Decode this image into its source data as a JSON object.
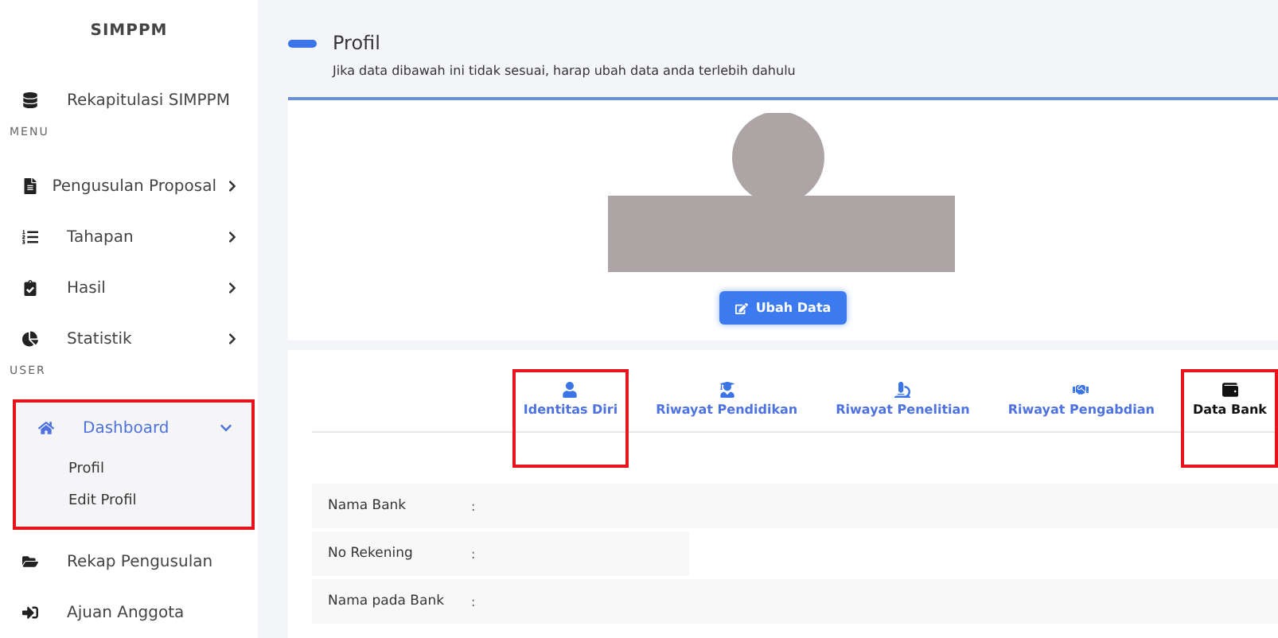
{
  "sidebar": {
    "title": "SIMPPM",
    "items": [
      {
        "kind": "link",
        "label": "Rekapitulasi SIMPPM",
        "expandable": false
      },
      {
        "kind": "heading",
        "label": "MENU"
      },
      {
        "kind": "link",
        "label": "Pengusulan Proposal",
        "expandable": true,
        "expanded": false
      },
      {
        "kind": "link",
        "label": "Tahapan",
        "expandable": true,
        "expanded": false
      },
      {
        "kind": "link",
        "label": "Hasil",
        "expandable": true,
        "expanded": false
      },
      {
        "kind": "link",
        "label": "Statistik",
        "expandable": true,
        "expanded": false
      },
      {
        "kind": "heading",
        "label": "USER"
      },
      {
        "kind": "link",
        "label": "Dashboard",
        "expandable": true,
        "expanded": true,
        "selected": true,
        "highlighted": true,
        "children": [
          {
            "label": "Profil"
          },
          {
            "label": "Edit Profil"
          }
        ]
      },
      {
        "kind": "link",
        "label": "Rekap Pengusulan",
        "expandable": false
      },
      {
        "kind": "link",
        "label": "Ajuan Anggota",
        "expandable": false
      }
    ]
  },
  "header": {
    "title": "Profil",
    "subtitle": "Jika data dibawah ini tidak sesuai, harap ubah data anda terlebih dahulu"
  },
  "profile": {
    "button": "Ubah Data"
  },
  "tabs": [
    {
      "label": "Identitas Diri",
      "selected": false,
      "highlighted": true
    },
    {
      "label": "Riwayat Pendidikan",
      "selected": false,
      "highlighted": false
    },
    {
      "label": "Riwayat Penelitian",
      "selected": false,
      "highlighted": false
    },
    {
      "label": "Riwayat Pengabdian",
      "selected": false,
      "highlighted": false
    },
    {
      "label": "Data Bank",
      "selected": true,
      "highlighted": true
    }
  ],
  "fields": [
    {
      "label": "Nama Bank",
      "separator": ":"
    },
    {
      "label": "No Rekening",
      "separator": ":"
    },
    {
      "label": "Nama pada Bank",
      "separator": ":"
    }
  ]
}
